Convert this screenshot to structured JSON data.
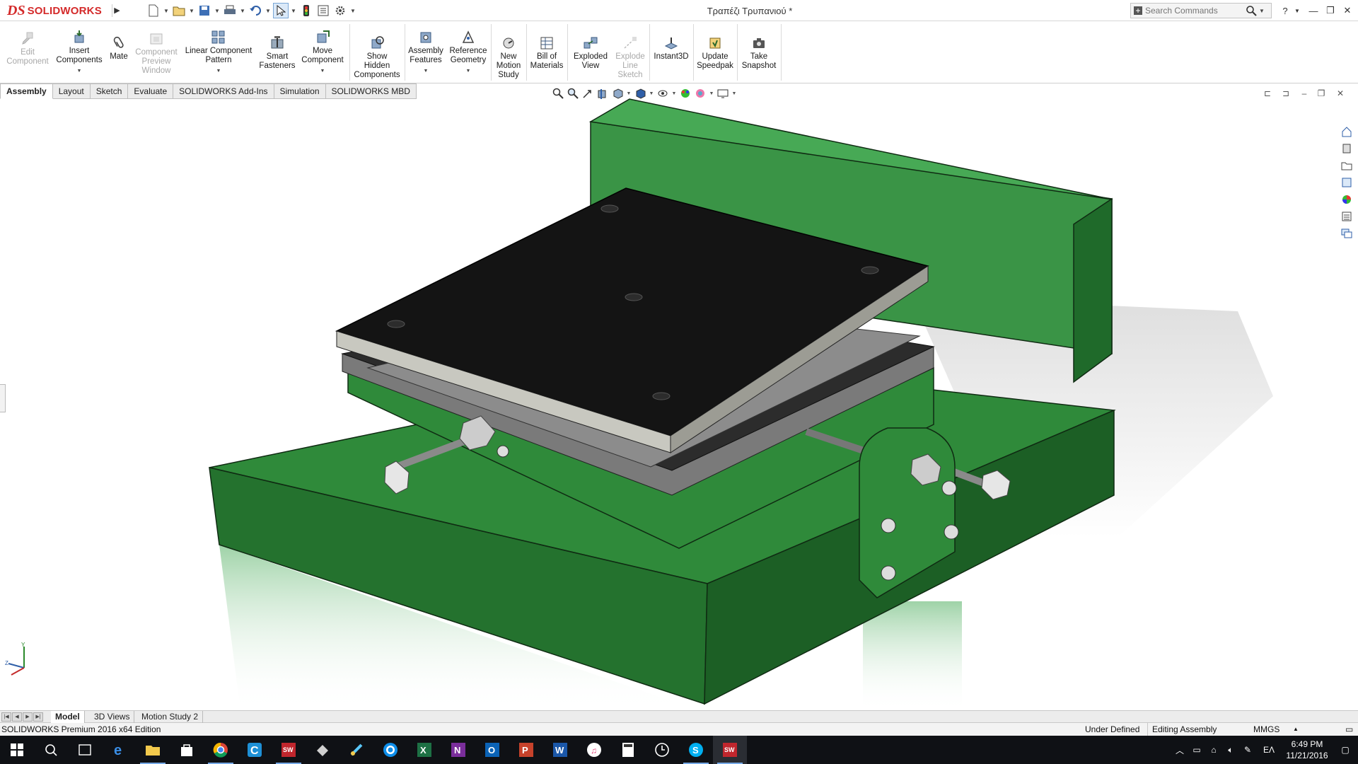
{
  "app": {
    "brand": "SOLIDWORKS",
    "document_title": "Τραπέζι Τρυπανιού *"
  },
  "search": {
    "placeholder": "Search Commands"
  },
  "ribbon": {
    "buttons": [
      {
        "id": "edit-component",
        "label": "Edit\nComponent",
        "icon": "edit-component-icon",
        "disabled": true
      },
      {
        "id": "insert-components",
        "label": "Insert\nComponents",
        "icon": "insert-components-icon",
        "dropdown": true
      },
      {
        "id": "mate",
        "label": "Mate",
        "icon": "paperclip-mate-icon"
      },
      {
        "id": "component-preview-window",
        "label": "Component\nPreview\nWindow",
        "icon": "preview-window-icon",
        "disabled": true
      },
      {
        "id": "linear-component-pattern",
        "label": "Linear Component\nPattern",
        "icon": "linear-pattern-icon",
        "dropdown": true
      },
      {
        "id": "smart-fasteners",
        "label": "Smart\nFasteners",
        "icon": "smart-fasteners-icon"
      },
      {
        "id": "move-component",
        "label": "Move\nComponent",
        "icon": "move-component-icon",
        "dropdown": true
      },
      {
        "id": "show-hidden-components",
        "label": "Show\nHidden\nComponents",
        "icon": "show-hidden-icon"
      },
      {
        "id": "assembly-features",
        "label": "Assembly\nFeatures",
        "icon": "assembly-features-icon",
        "dropdown": true
      },
      {
        "id": "reference-geometry",
        "label": "Reference\nGeometry",
        "icon": "reference-geometry-icon",
        "dropdown": true
      },
      {
        "id": "new-motion-study",
        "label": "New\nMotion\nStudy",
        "icon": "motion-study-icon"
      },
      {
        "id": "bill-of-materials",
        "label": "Bill of\nMaterials",
        "icon": "bill-of-materials-icon"
      },
      {
        "id": "exploded-view",
        "label": "Exploded\nView",
        "icon": "exploded-view-icon"
      },
      {
        "id": "explode-line-sketch",
        "label": "Explode\nLine\nSketch",
        "icon": "explode-line-sketch-icon",
        "disabled": true
      },
      {
        "id": "instant3d",
        "label": "Instant3D",
        "icon": "instant3d-icon"
      },
      {
        "id": "update-speedpak",
        "label": "Update\nSpeedpak",
        "icon": "speedpak-icon"
      },
      {
        "id": "take-snapshot",
        "label": "Take\nSnapshot",
        "icon": "camera-icon"
      }
    ]
  },
  "tabs": [
    "Assembly",
    "Layout",
    "Sketch",
    "Evaluate",
    "SOLIDWORKS Add-Ins",
    "Simulation",
    "SOLIDWORKS MBD"
  ],
  "bottom_tabs": [
    "Model",
    "3D Views",
    "Motion Study 2"
  ],
  "status": {
    "edition": "SOLIDWORKS Premium 2016 x64 Edition",
    "state": "Under Defined",
    "mode": "Editing Assembly",
    "units": "MMGS"
  },
  "taskbar": {
    "time": "6:49 PM",
    "date": "11/21/2016",
    "language": "EΛ"
  },
  "colors": {
    "base_green": "#2f8a3a",
    "top_plate": "#151515",
    "brand_red": "#d42a2a"
  }
}
